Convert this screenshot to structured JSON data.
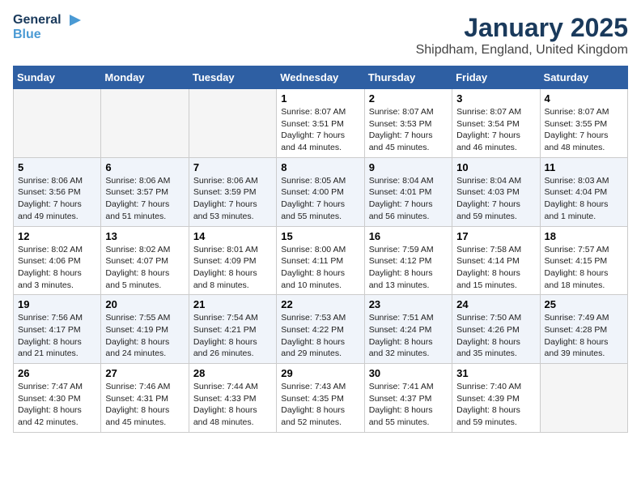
{
  "header": {
    "logo_line1": "General",
    "logo_line2": "Blue",
    "title": "January 2025",
    "subtitle": "Shipdham, England, United Kingdom"
  },
  "weekdays": [
    "Sunday",
    "Monday",
    "Tuesday",
    "Wednesday",
    "Thursday",
    "Friday",
    "Saturday"
  ],
  "weeks": [
    [
      {
        "day": "",
        "text": ""
      },
      {
        "day": "",
        "text": ""
      },
      {
        "day": "",
        "text": ""
      },
      {
        "day": "1",
        "text": "Sunrise: 8:07 AM\nSunset: 3:51 PM\nDaylight: 7 hours\nand 44 minutes."
      },
      {
        "day": "2",
        "text": "Sunrise: 8:07 AM\nSunset: 3:53 PM\nDaylight: 7 hours\nand 45 minutes."
      },
      {
        "day": "3",
        "text": "Sunrise: 8:07 AM\nSunset: 3:54 PM\nDaylight: 7 hours\nand 46 minutes."
      },
      {
        "day": "4",
        "text": "Sunrise: 8:07 AM\nSunset: 3:55 PM\nDaylight: 7 hours\nand 48 minutes."
      }
    ],
    [
      {
        "day": "5",
        "text": "Sunrise: 8:06 AM\nSunset: 3:56 PM\nDaylight: 7 hours\nand 49 minutes."
      },
      {
        "day": "6",
        "text": "Sunrise: 8:06 AM\nSunset: 3:57 PM\nDaylight: 7 hours\nand 51 minutes."
      },
      {
        "day": "7",
        "text": "Sunrise: 8:06 AM\nSunset: 3:59 PM\nDaylight: 7 hours\nand 53 minutes."
      },
      {
        "day": "8",
        "text": "Sunrise: 8:05 AM\nSunset: 4:00 PM\nDaylight: 7 hours\nand 55 minutes."
      },
      {
        "day": "9",
        "text": "Sunrise: 8:04 AM\nSunset: 4:01 PM\nDaylight: 7 hours\nand 56 minutes."
      },
      {
        "day": "10",
        "text": "Sunrise: 8:04 AM\nSunset: 4:03 PM\nDaylight: 7 hours\nand 59 minutes."
      },
      {
        "day": "11",
        "text": "Sunrise: 8:03 AM\nSunset: 4:04 PM\nDaylight: 8 hours\nand 1 minute."
      }
    ],
    [
      {
        "day": "12",
        "text": "Sunrise: 8:02 AM\nSunset: 4:06 PM\nDaylight: 8 hours\nand 3 minutes."
      },
      {
        "day": "13",
        "text": "Sunrise: 8:02 AM\nSunset: 4:07 PM\nDaylight: 8 hours\nand 5 minutes."
      },
      {
        "day": "14",
        "text": "Sunrise: 8:01 AM\nSunset: 4:09 PM\nDaylight: 8 hours\nand 8 minutes."
      },
      {
        "day": "15",
        "text": "Sunrise: 8:00 AM\nSunset: 4:11 PM\nDaylight: 8 hours\nand 10 minutes."
      },
      {
        "day": "16",
        "text": "Sunrise: 7:59 AM\nSunset: 4:12 PM\nDaylight: 8 hours\nand 13 minutes."
      },
      {
        "day": "17",
        "text": "Sunrise: 7:58 AM\nSunset: 4:14 PM\nDaylight: 8 hours\nand 15 minutes."
      },
      {
        "day": "18",
        "text": "Sunrise: 7:57 AM\nSunset: 4:15 PM\nDaylight: 8 hours\nand 18 minutes."
      }
    ],
    [
      {
        "day": "19",
        "text": "Sunrise: 7:56 AM\nSunset: 4:17 PM\nDaylight: 8 hours\nand 21 minutes."
      },
      {
        "day": "20",
        "text": "Sunrise: 7:55 AM\nSunset: 4:19 PM\nDaylight: 8 hours\nand 24 minutes."
      },
      {
        "day": "21",
        "text": "Sunrise: 7:54 AM\nSunset: 4:21 PM\nDaylight: 8 hours\nand 26 minutes."
      },
      {
        "day": "22",
        "text": "Sunrise: 7:53 AM\nSunset: 4:22 PM\nDaylight: 8 hours\nand 29 minutes."
      },
      {
        "day": "23",
        "text": "Sunrise: 7:51 AM\nSunset: 4:24 PM\nDaylight: 8 hours\nand 32 minutes."
      },
      {
        "day": "24",
        "text": "Sunrise: 7:50 AM\nSunset: 4:26 PM\nDaylight: 8 hours\nand 35 minutes."
      },
      {
        "day": "25",
        "text": "Sunrise: 7:49 AM\nSunset: 4:28 PM\nDaylight: 8 hours\nand 39 minutes."
      }
    ],
    [
      {
        "day": "26",
        "text": "Sunrise: 7:47 AM\nSunset: 4:30 PM\nDaylight: 8 hours\nand 42 minutes."
      },
      {
        "day": "27",
        "text": "Sunrise: 7:46 AM\nSunset: 4:31 PM\nDaylight: 8 hours\nand 45 minutes."
      },
      {
        "day": "28",
        "text": "Sunrise: 7:44 AM\nSunset: 4:33 PM\nDaylight: 8 hours\nand 48 minutes."
      },
      {
        "day": "29",
        "text": "Sunrise: 7:43 AM\nSunset: 4:35 PM\nDaylight: 8 hours\nand 52 minutes."
      },
      {
        "day": "30",
        "text": "Sunrise: 7:41 AM\nSunset: 4:37 PM\nDaylight: 8 hours\nand 55 minutes."
      },
      {
        "day": "31",
        "text": "Sunrise: 7:40 AM\nSunset: 4:39 PM\nDaylight: 8 hours\nand 59 minutes."
      },
      {
        "day": "",
        "text": ""
      }
    ]
  ]
}
